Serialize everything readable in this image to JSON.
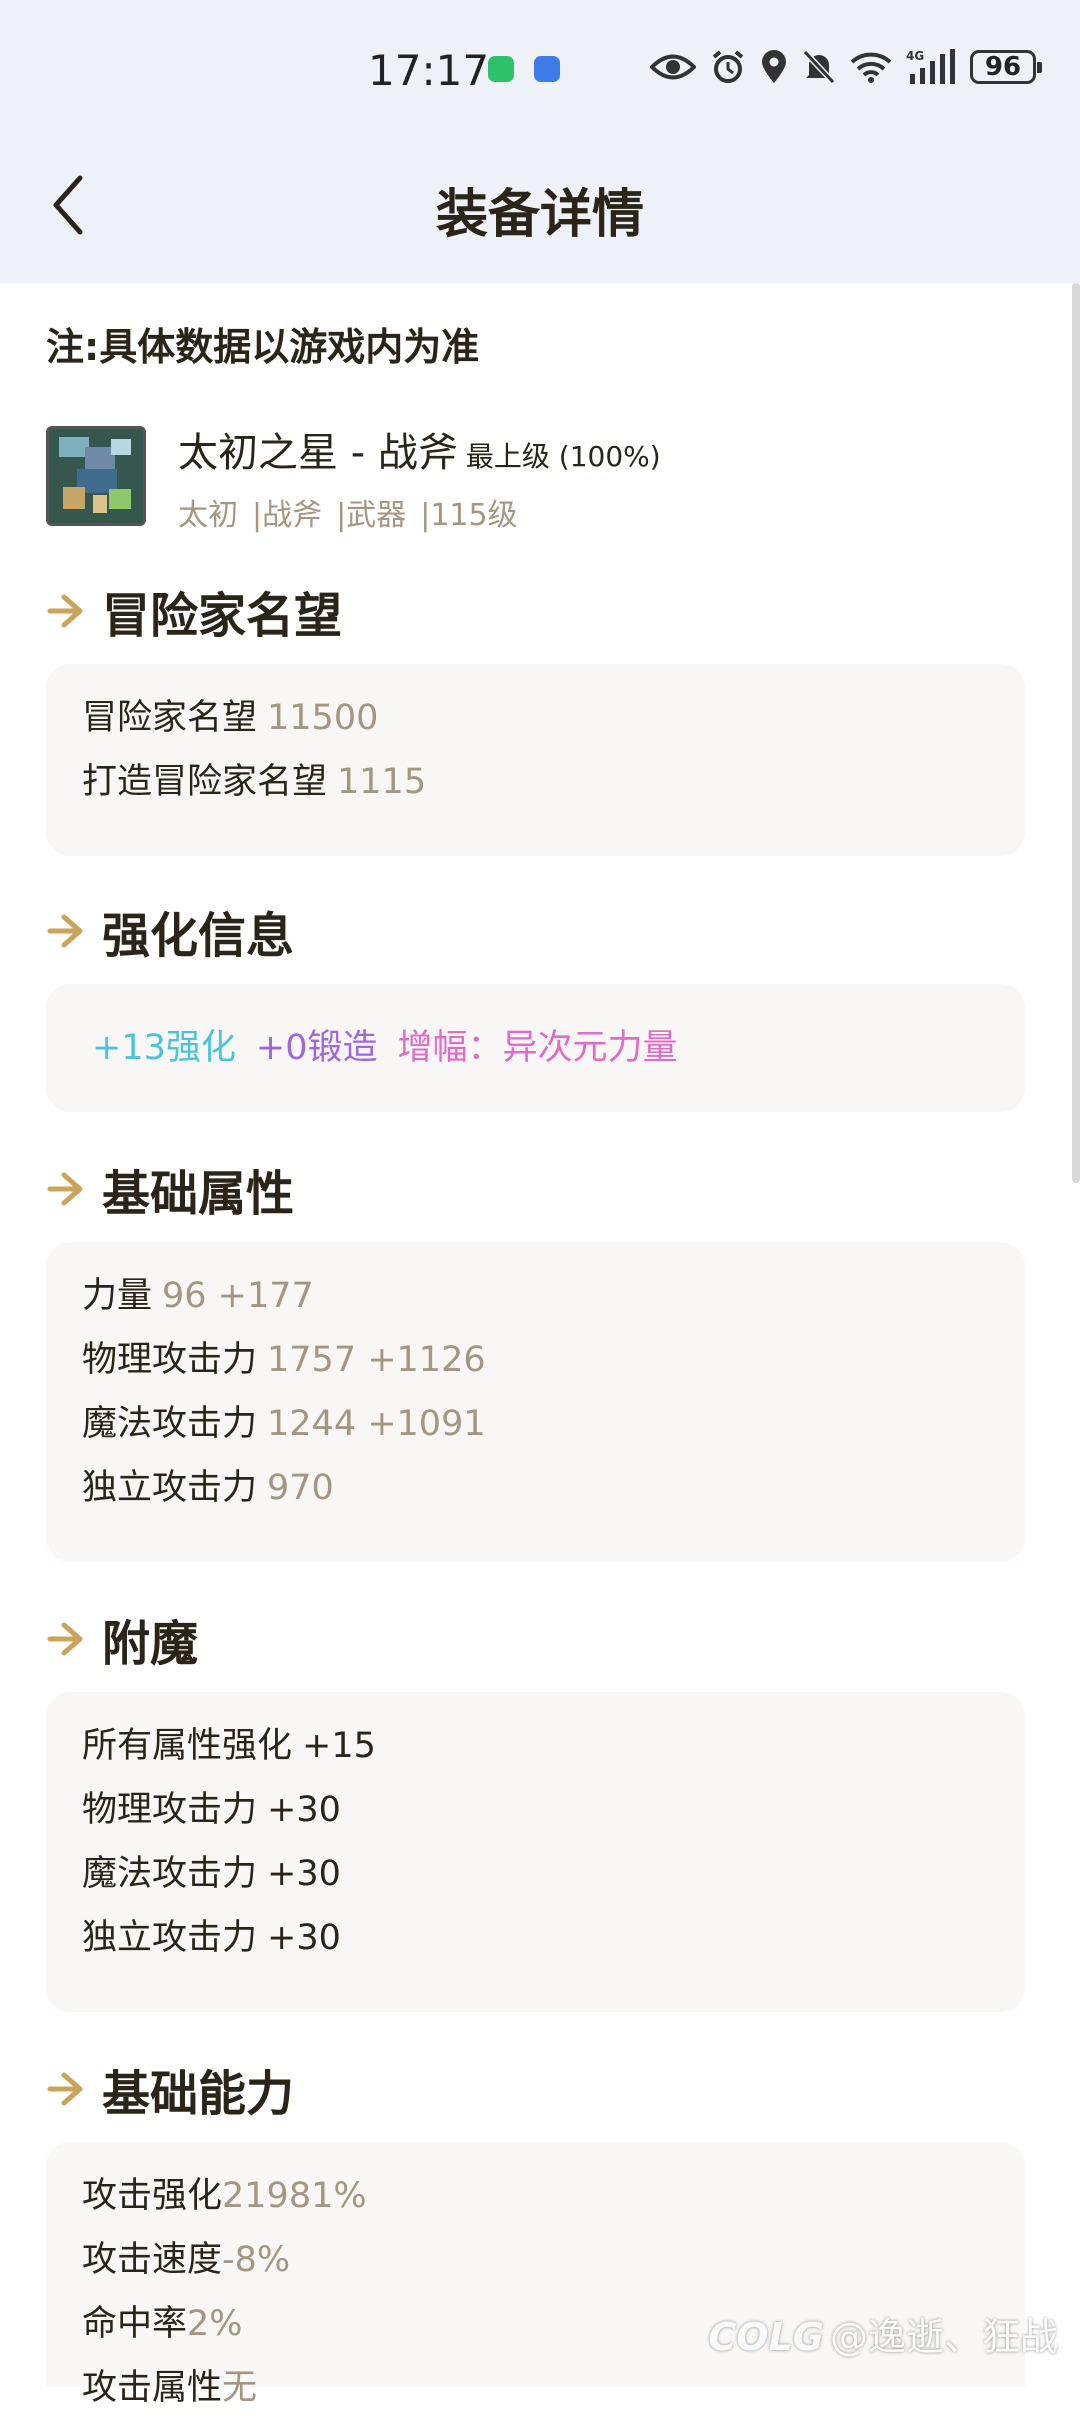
{
  "status": {
    "time": "17:17",
    "battery": "96",
    "network": "4G"
  },
  "header": {
    "title": "装备详情"
  },
  "note": "注:具体数据以游戏内为准",
  "equipment": {
    "name": "太初之星 - 战斧",
    "grade": "最上级 (100%)",
    "tags": [
      "太初",
      "|战斧",
      "|武器",
      "|115级"
    ]
  },
  "sections": {
    "fame": {
      "title": "冒险家名望",
      "rows": [
        {
          "label": "冒险家名望",
          "value": "11500"
        },
        {
          "label": "打造冒险家名望",
          "value": "1115"
        }
      ]
    },
    "enhance": {
      "title": "强化信息",
      "items": [
        {
          "text": "+13强化",
          "color": "#4cc3d9"
        },
        {
          "text": "+0锻造",
          "color": "#a066e0"
        },
        {
          "text": "增幅：",
          "color": "#e06bc8"
        },
        {
          "text": "异次元力量",
          "color": "#e06bc8"
        }
      ]
    },
    "base_attrs": {
      "title": "基础属性",
      "rows": [
        {
          "label": "力量",
          "value": "96 +177"
        },
        {
          "label": "物理攻击力",
          "value": "1757 +1126"
        },
        {
          "label": "魔法攻击力",
          "value": "1244 +1091"
        },
        {
          "label": "独立攻击力",
          "value": "970"
        }
      ]
    },
    "enchant": {
      "title": "附魔",
      "rows": [
        {
          "label": "所有属性强化",
          "value": "+15"
        },
        {
          "label": "物理攻击力",
          "value": "+30"
        },
        {
          "label": "魔法攻击力",
          "value": "+30"
        },
        {
          "label": "独立攻击力",
          "value": "+30"
        }
      ]
    },
    "base_ability": {
      "title": "基础能力",
      "rows": [
        {
          "label": "攻击强化",
          "value": "21981%"
        },
        {
          "label": "攻击速度",
          "value": "-8%"
        },
        {
          "label": "命中率",
          "value": "2%"
        },
        {
          "label": "攻击属性",
          "value": "无"
        }
      ]
    }
  },
  "watermark": {
    "logo": "COLG",
    "text": "@逸逝、狂战"
  },
  "colors": {
    "accent_gold": "#c9a45a",
    "muted_value": "#a49680",
    "title_text": "#2b2418"
  },
  "icons": [
    "back-arrow-icon",
    "wechat-icon",
    "app-icon",
    "eye-icon",
    "alarm-icon",
    "location-icon",
    "mute-icon",
    "wifi-icon",
    "signal-icon",
    "battery-icon",
    "section-arrow-icon"
  ]
}
